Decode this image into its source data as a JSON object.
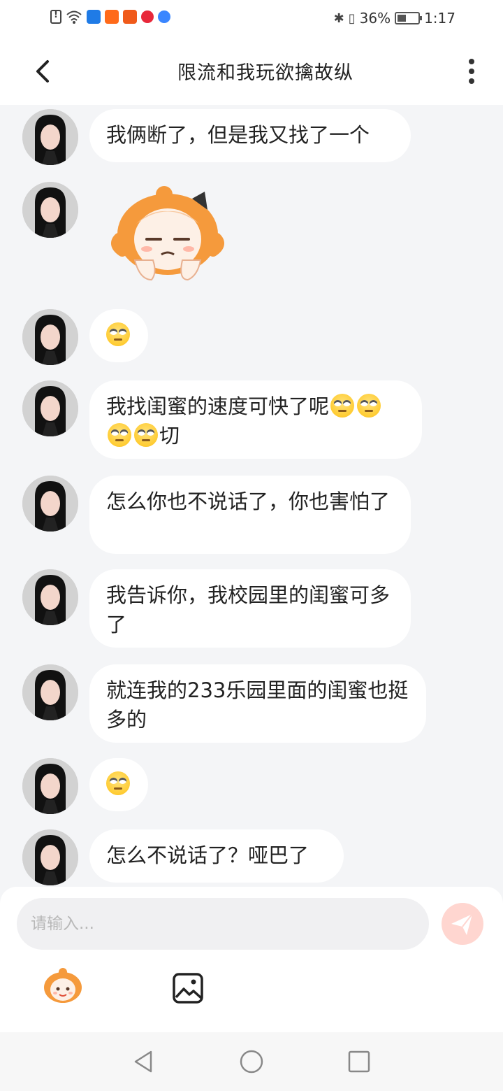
{
  "status_bar": {
    "battery": "36%",
    "time": "1:17"
  },
  "header": {
    "title": "限流和我玩欲擒故纵"
  },
  "messages": [
    {
      "text": "我俩断了，但是我又找了一个"
    },
    {
      "sticker": "sad-cartoon-sticker"
    },
    {
      "emoji": "eye-roll"
    },
    {
      "text_a": "我找闺蜜的速度可快了呢",
      "text_b": "切"
    },
    {
      "text": "怎么你也不说话了，你也害怕了"
    },
    {
      "text": "我告诉你，我校园里的闺蜜可多了"
    },
    {
      "text": "就连我的233乐园里面的闺蜜也挺多的"
    },
    {
      "emoji": "eye-roll"
    },
    {
      "text": "怎么不说话了？哑巴了"
    }
  ],
  "input": {
    "placeholder": "请输入..."
  },
  "colors": {
    "accent": "#ff7a5a",
    "background": "#f4f5f7",
    "bubble": "#ffffff"
  }
}
